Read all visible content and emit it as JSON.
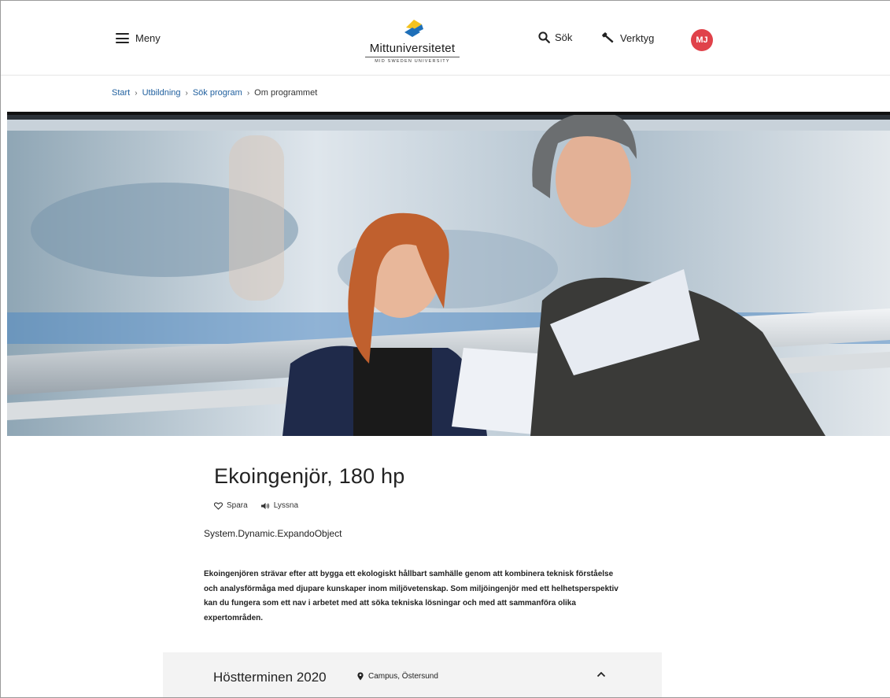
{
  "header": {
    "menu_label": "Meny",
    "logo_name": "Mittuniversitetet",
    "logo_sub": "MID SWEDEN UNIVERSITY",
    "search_label": "Sök",
    "tools_label": "Verktyg",
    "avatar_initials": "MJ"
  },
  "breadcrumb": {
    "items": [
      "Start",
      "Utbildning",
      "Sök program"
    ],
    "current": "Om programmet"
  },
  "program": {
    "title": "Ekoingenjör, 180 hp",
    "save_label": "Spara",
    "listen_label": "Lyssna",
    "subtitle": "System.Dynamic.ExpandoObject",
    "description": "Ekoingenjören strävar efter att bygga ett ekologiskt hållbart samhälle genom att kombinera teknisk förståelse och analysförmåga med djupare kunskaper inom miljövetenskap. Som miljöingenjör med ett helhetsperspektiv kan du fungera som ett nav i arbetet med att söka tekniska lösningar och med att sammanföra olika expertområden."
  },
  "semester": {
    "title": "Höstterminen 2020",
    "campus": "Campus, Östersund"
  },
  "colors": {
    "link": "#1f5f9e",
    "avatar": "#e0424a",
    "logo_yellow": "#f4c21e",
    "logo_blue": "#1e6fb8"
  }
}
